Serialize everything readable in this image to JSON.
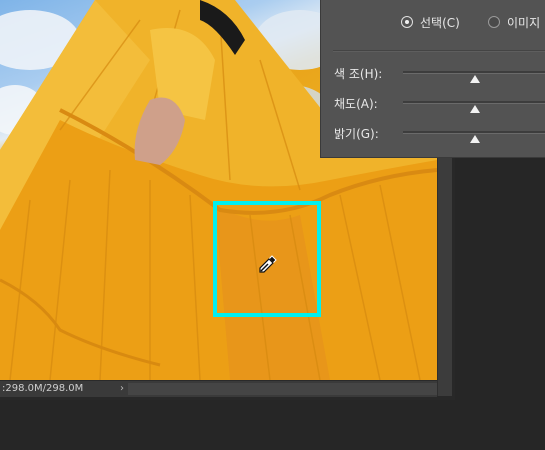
{
  "panel": {
    "radio_selection_label": "선택(C)",
    "radio_image_label": "이미지",
    "sliders": [
      {
        "label": "색 조(H):",
        "value": 0.5
      },
      {
        "label": "채도(A):",
        "value": 0.5
      },
      {
        "label": "밝기(G):",
        "value": 0.5
      }
    ]
  },
  "status": {
    "doc_size": ":298.0M/298.0M",
    "arrow": "›"
  },
  "colors": {
    "selection_box": "#00f0f0",
    "panel_bg": "#535353",
    "app_bg": "#262626"
  },
  "icons": {
    "cursor": "eyedropper-icon"
  }
}
